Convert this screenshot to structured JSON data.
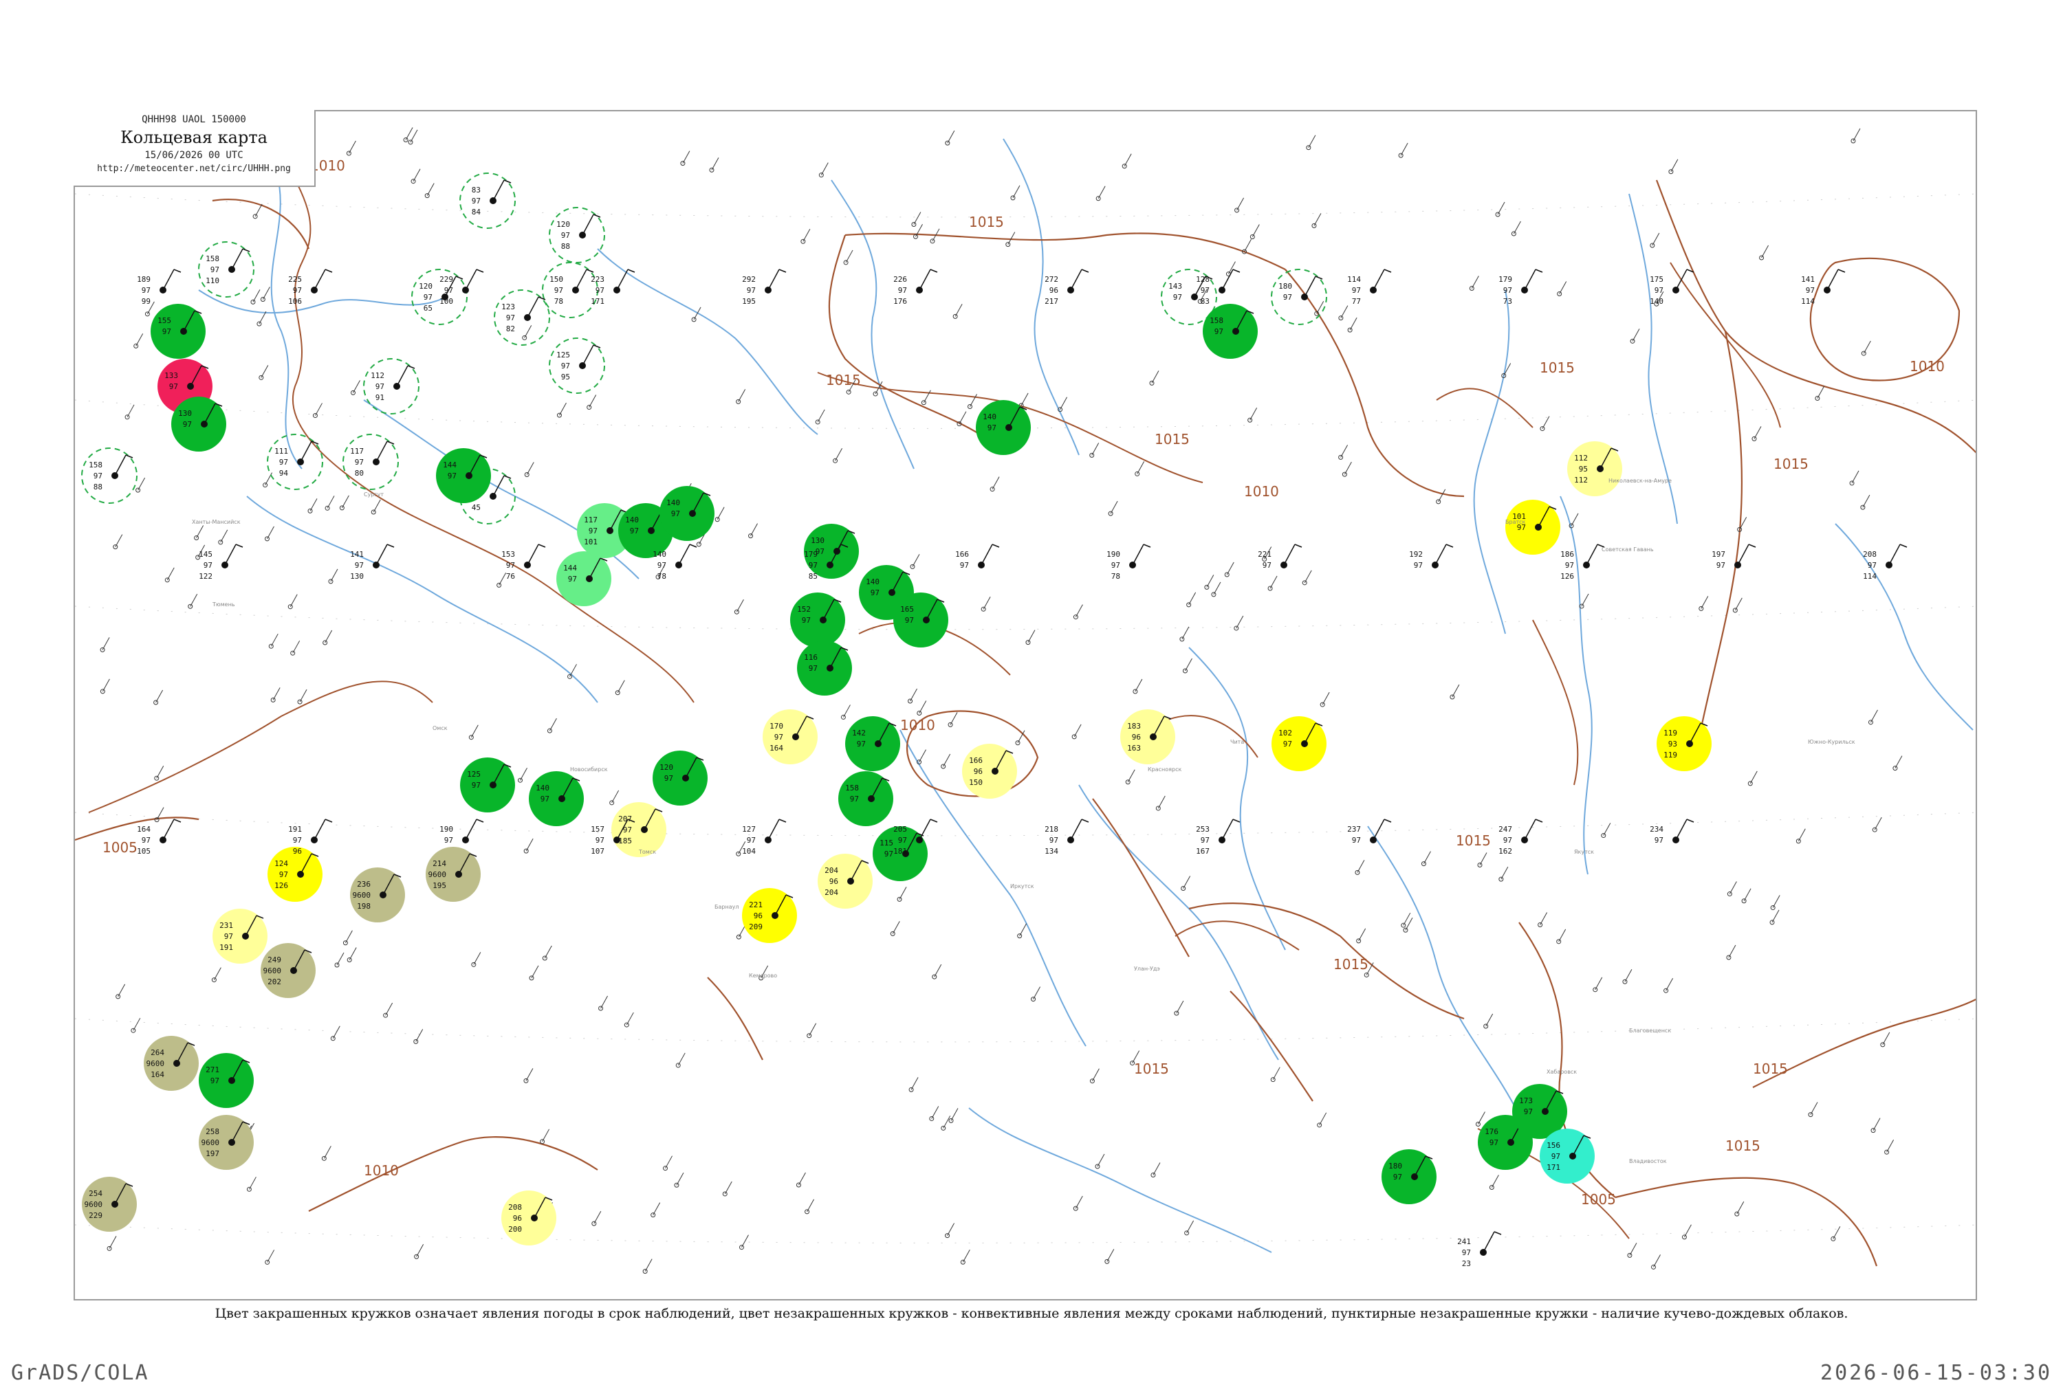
{
  "header": {
    "code_line": "QHHH98  UAOL  150000",
    "title": "Кольцевая карта",
    "date_line": "15/06/2026 00 UTC",
    "url": "http://meteocenter.net/circ/UHHH.png"
  },
  "legend_note": "Цвет закрашенных кружков означает явления погоды в срок наблюдений, цвет незакрашенных кружков - конвективные явления между сроками наблюдений, пунктирные незакрашенные кружки - наличие кучево-дождевых облаков.",
  "footer": {
    "software": "GrADS/COLA",
    "timestamp": "2026-06-15-03:30"
  },
  "colors": {
    "isobar": "#a0522d",
    "river": "#6ea8dc",
    "green_fill": "#08b52a",
    "red_fill": "#f0205a",
    "yellow_fill": "#ffff00",
    "pale_yellow_fill": "#ffff99",
    "olive_fill": "#bdbd8a",
    "light_green_fill": "#66ee88",
    "cyan_fill": "#33eecc",
    "dashed_ring": "#22aa44"
  },
  "isobar_labels": [
    "1010",
    "1015",
    "1015",
    "1015",
    "1015",
    "1010",
    "1015",
    "1010",
    "1005",
    "1010",
    "1015",
    "1015",
    "1015",
    "1015",
    "1010",
    "1005",
    "1015"
  ],
  "stations": [
    {
      "t": "112",
      "p": "97",
      "d": "91",
      "name": "",
      "style": "dashed"
    },
    {
      "t": "83",
      "p": "97",
      "d": "84",
      "name": "",
      "style": "dashed"
    },
    {
      "t": "158",
      "p": "97",
      "d": "110",
      "name": "",
      "style": "dashed"
    },
    {
      "t": "120",
      "p": "97",
      "d": "88",
      "name": "",
      "style": "dashed"
    },
    {
      "t": "150",
      "p": "97",
      "d": "78",
      "name": "",
      "style": "dashed"
    },
    {
      "t": "120",
      "p": "97",
      "d": "65",
      "name": "",
      "style": "dashed"
    },
    {
      "t": "123",
      "p": "97",
      "d": "82",
      "name": "",
      "style": "dashed"
    },
    {
      "t": "155",
      "p": "97",
      "d": "",
      "name": "",
      "style": "green"
    },
    {
      "t": "133",
      "p": "97",
      "d": "",
      "name": "",
      "style": "red"
    },
    {
      "t": "130",
      "p": "97",
      "d": "",
      "name": "",
      "style": "green"
    },
    {
      "t": "158",
      "p": "97",
      "d": "88",
      "name": "",
      "style": "dashed"
    },
    {
      "t": "111",
      "p": "97",
      "d": "94",
      "name": "",
      "style": "dashed"
    },
    {
      "t": "117",
      "p": "97",
      "d": "80",
      "name": "",
      "style": "dashed"
    },
    {
      "t": "125",
      "p": "97",
      "d": "95",
      "name": "",
      "style": "dashed"
    },
    {
      "t": "120",
      "p": "97",
      "d": "45",
      "name": "",
      "style": "dashed"
    },
    {
      "t": "144",
      "p": "97",
      "d": "",
      "name": "",
      "style": "green"
    },
    {
      "t": "144",
      "p": "97",
      "d": "",
      "name": "",
      "style": "lightgreen"
    },
    {
      "t": "117",
      "p": "97",
      "d": "101",
      "name": "",
      "style": "lightgreen"
    },
    {
      "t": "140",
      "p": "97",
      "d": "",
      "name": "",
      "style": "green"
    },
    {
      "t": "140",
      "p": "97",
      "d": "",
      "name": "",
      "style": "green"
    },
    {
      "t": "143",
      "p": "97",
      "d": "",
      "name": "",
      "style": "dashed"
    },
    {
      "t": "180",
      "p": "97",
      "d": "",
      "name": "",
      "style": "dashed"
    },
    {
      "t": "158",
      "p": "97",
      "d": "",
      "name": "",
      "style": "green"
    },
    {
      "t": "140",
      "p": "97",
      "d": "",
      "name": "",
      "style": "green"
    },
    {
      "t": "130",
      "p": "97",
      "d": "",
      "name": "",
      "style": "green"
    },
    {
      "t": "152",
      "p": "97",
      "d": "",
      "name": "",
      "style": "green"
    },
    {
      "t": "116",
      "p": "97",
      "d": "",
      "name": "",
      "style": "green"
    },
    {
      "t": "140",
      "p": "97",
      "d": "",
      "name": "",
      "style": "green"
    },
    {
      "t": "165",
      "p": "97",
      "d": "",
      "name": "",
      "style": "green"
    },
    {
      "t": "170",
      "p": "97",
      "d": "164",
      "name": "",
      "style": "paleyellow"
    },
    {
      "t": "142",
      "p": "97",
      "d": "",
      "name": "",
      "style": "green"
    },
    {
      "t": "158",
      "p": "97",
      "d": "",
      "name": "",
      "style": "green"
    },
    {
      "t": "166",
      "p": "96",
      "d": "150",
      "name": "",
      "style": "paleyellow"
    },
    {
      "t": "183",
      "p": "96",
      "d": "163",
      "name": "",
      "style": "paleyellow"
    },
    {
      "t": "102",
      "p": "97",
      "d": "",
      "name": "",
      "style": "yellow"
    },
    {
      "t": "112",
      "p": "95",
      "d": "112",
      "name": "",
      "style": "paleyellow"
    },
    {
      "t": "101",
      "p": "97",
      "d": "",
      "name": "",
      "style": "yellow"
    },
    {
      "t": "119",
      "p": "93",
      "d": "119",
      "name": "",
      "style": "yellow"
    },
    {
      "t": "120",
      "p": "97",
      "d": "",
      "name": "",
      "style": "green"
    },
    {
      "t": "125",
      "p": "97",
      "d": "",
      "name": "",
      "style": "green"
    },
    {
      "t": "140",
      "p": "97",
      "d": "",
      "name": "",
      "style": "green"
    },
    {
      "t": "115",
      "p": "97",
      "d": "",
      "name": "",
      "style": "green"
    },
    {
      "t": "207",
      "p": "97",
      "d": "185",
      "name": "",
      "style": "paleyellow"
    },
    {
      "t": "124",
      "p": "97",
      "d": "126",
      "name": "",
      "style": "yellow"
    },
    {
      "t": "214",
      "p": "9600",
      "d": "195",
      "name": "",
      "style": "olive"
    },
    {
      "t": "236",
      "p": "9600",
      "d": "198",
      "name": "",
      "style": "olive"
    },
    {
      "t": "231",
      "p": "97",
      "d": "191",
      "name": "",
      "style": "paleyellow"
    },
    {
      "t": "249",
      "p": "9600",
      "d": "202",
      "name": "",
      "style": "olive"
    },
    {
      "t": "264",
      "p": "9600",
      "d": "164",
      "name": "",
      "style": "olive"
    },
    {
      "t": "271",
      "p": "97",
      "d": "",
      "name": "",
      "style": "green"
    },
    {
      "t": "258",
      "p": "9600",
      "d": "197",
      "name": "",
      "style": "olive"
    },
    {
      "t": "254",
      "p": "9600",
      "d": "229",
      "name": "",
      "style": "olive"
    },
    {
      "t": "208",
      "p": "96",
      "d": "200",
      "name": "",
      "style": "paleyellow"
    },
    {
      "t": "204",
      "p": "96",
      "d": "204",
      "name": "",
      "style": "paleyellow"
    },
    {
      "t": "221",
      "p": "96",
      "d": "209",
      "name": "",
      "style": "yellow"
    },
    {
      "t": "176",
      "p": "97",
      "d": "",
      "name": "",
      "style": "green"
    },
    {
      "t": "173",
      "p": "97",
      "d": "",
      "name": "",
      "style": "green"
    },
    {
      "t": "156",
      "p": "97",
      "d": "171",
      "name": "",
      "style": "cyan"
    },
    {
      "t": "180",
      "p": "97",
      "d": "",
      "name": "",
      "style": "green"
    },
    {
      "t": "241",
      "p": "97",
      "d": "23",
      "name": "",
      "style": "plain"
    },
    {
      "t": "189",
      "p": "97",
      "d": "99",
      "name": "",
      "style": "plain"
    },
    {
      "t": "225",
      "p": "97",
      "d": "106",
      "name": "",
      "style": "plain"
    },
    {
      "t": "229",
      "p": "97",
      "d": "100",
      "name": "",
      "style": "plain"
    },
    {
      "t": "223",
      "p": "97",
      "d": "171",
      "name": "",
      "style": "plain"
    },
    {
      "t": "292",
      "p": "97",
      "d": "195",
      "name": "",
      "style": "plain"
    },
    {
      "t": "226",
      "p": "97",
      "d": "176",
      "name": "",
      "style": "plain"
    },
    {
      "t": "272",
      "p": "96",
      "d": "217",
      "name": "",
      "style": "plain"
    },
    {
      "t": "128",
      "p": "97",
      "d": "83",
      "name": "",
      "style": "plain"
    },
    {
      "t": "114",
      "p": "97",
      "d": "77",
      "name": "",
      "style": "plain"
    },
    {
      "t": "179",
      "p": "97",
      "d": "73",
      "name": "",
      "style": "plain"
    },
    {
      "t": "175",
      "p": "97",
      "d": "140",
      "name": "",
      "style": "plain"
    },
    {
      "t": "141",
      "p": "97",
      "d": "114",
      "name": "",
      "style": "plain"
    },
    {
      "t": "145",
      "p": "97",
      "d": "122",
      "name": "",
      "style": "plain"
    },
    {
      "t": "141",
      "p": "97",
      "d": "130",
      "name": "",
      "style": "plain"
    },
    {
      "t": "153",
      "p": "97",
      "d": "76",
      "name": "",
      "style": "plain"
    },
    {
      "t": "140",
      "p": "97",
      "d": "78",
      "name": "",
      "style": "plain"
    },
    {
      "t": "179",
      "p": "97",
      "d": "85",
      "name": "",
      "style": "plain"
    },
    {
      "t": "166",
      "p": "97",
      "d": "",
      "name": "",
      "style": "plain"
    },
    {
      "t": "190",
      "p": "97",
      "d": "78",
      "name": "",
      "style": "plain"
    },
    {
      "t": "221",
      "p": "97",
      "d": "",
      "name": "",
      "style": "plain"
    },
    {
      "t": "192",
      "p": "97",
      "d": "",
      "name": "",
      "style": "plain"
    },
    {
      "t": "186",
      "p": "97",
      "d": "126",
      "name": "",
      "style": "plain"
    },
    {
      "t": "197",
      "p": "97",
      "d": "",
      "name": "",
      "style": "plain"
    },
    {
      "t": "208",
      "p": "97",
      "d": "114",
      "name": "",
      "style": "plain"
    },
    {
      "t": "164",
      "p": "97",
      "d": "105",
      "name": "",
      "style": "plain"
    },
    {
      "t": "191",
      "p": "97",
      "d": "96",
      "name": "",
      "style": "plain"
    },
    {
      "t": "190",
      "p": "97",
      "d": "",
      "name": "",
      "style": "plain"
    },
    {
      "t": "157",
      "p": "97",
      "d": "107",
      "name": "",
      "style": "plain"
    },
    {
      "t": "127",
      "p": "97",
      "d": "104",
      "name": "",
      "style": "plain"
    },
    {
      "t": "205",
      "p": "97",
      "d": "181",
      "name": "",
      "style": "plain"
    },
    {
      "t": "218",
      "p": "97",
      "d": "134",
      "name": "",
      "style": "plain"
    },
    {
      "t": "253",
      "p": "97",
      "d": "167",
      "name": "",
      "style": "plain"
    },
    {
      "t": "237",
      "p": "97",
      "d": "",
      "name": "",
      "style": "plain"
    },
    {
      "t": "247",
      "p": "97",
      "d": "162",
      "name": "",
      "style": "plain"
    },
    {
      "t": "234",
      "p": "97",
      "d": "",
      "name": "",
      "style": "plain"
    }
  ],
  "station_name_samples": [
    "Сургут",
    "Ханты-Мансийск",
    "Тюмень",
    "Омск",
    "Новосибирск",
    "Томск",
    "Барнаул",
    "Кемерово",
    "Красноярск",
    "Иркутск",
    "Улан-Удэ",
    "Чита",
    "Братск",
    "Якутск",
    "Благовещенск",
    "Хабаровск",
    "Владивосток",
    "Южно-Курильск",
    "Николаевск-на-Амуре",
    "Советская Гавань"
  ]
}
